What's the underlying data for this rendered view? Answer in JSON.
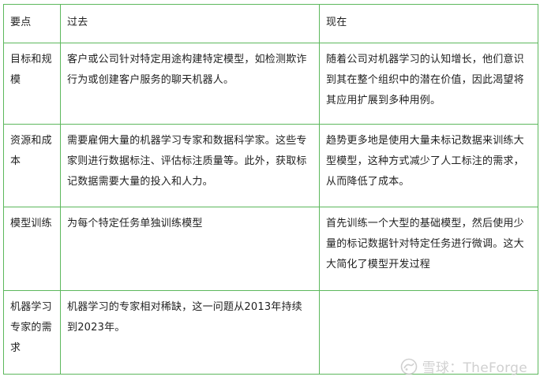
{
  "table": {
    "headers": [
      "要点",
      "过去",
      "现在"
    ],
    "rows": [
      {
        "key": "目标和规模",
        "past": "客户或公司针对特定用途构建特定模型，如检测欺诈行为或创建客户服务的聊天机器人。",
        "now": "随着公司对机器学习的认知增长，他们意识到其在整个组织中的潜在价值，因此渴望将其应用扩展到多种用例。"
      },
      {
        "key": "资源和成本",
        "past": "需要雇佣大量的机器学习专家和数据科学家。这些专家则进行数据标注、评估标注质量等。此外，获取标记数据需要大量的投入和人力。",
        "now": "趋势更多地是使用大量未标记数据来训练大型模型，这种方式减少了人工标注的需求，从而降低了成本。"
      },
      {
        "key": "模型训练",
        "past": "为每个特定任务单独训练模型",
        "now": "首先训练一个大型的基础模型，然后使用少量的标记数据针对特定任务进行微调。这大大简化了模型开发过程"
      },
      {
        "key": "机器学习专家的需求",
        "past": "机器学习的专家相对稀缺，这一问题从2013年持续到2023年。",
        "now": ""
      }
    ]
  },
  "watermark": {
    "text": "雪球：TheForge",
    "icon": "snowball-icon"
  }
}
